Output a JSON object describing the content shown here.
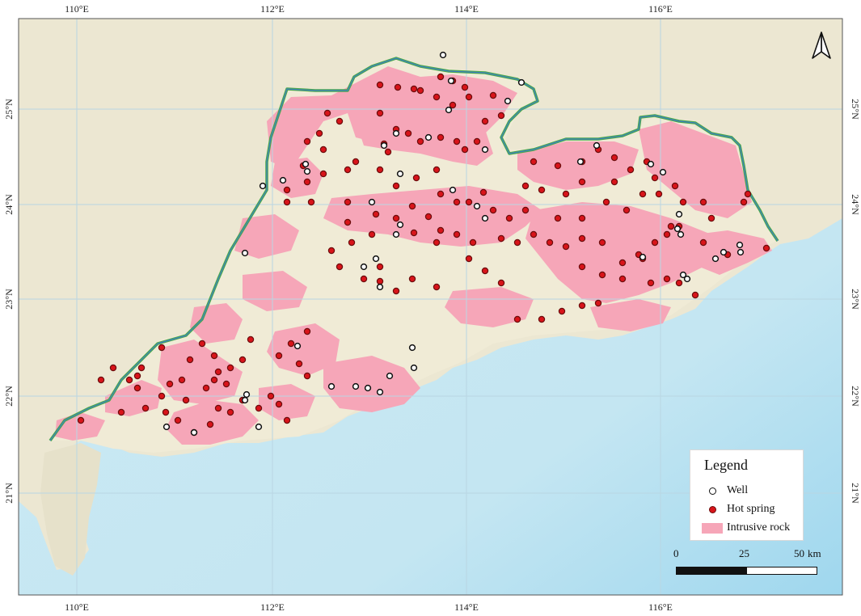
{
  "map": {
    "graticule": {
      "top_lon": [
        "110°E",
        "112°E",
        "114°E",
        "116°E"
      ],
      "bottom_lon": [
        "110°E",
        "112°E",
        "114°E",
        "116°E"
      ],
      "left_lat": [
        "25°N",
        "24°N",
        "23°N",
        "22°N",
        "21°N"
      ],
      "right_lat": [
        "25°N",
        "24°N",
        "23°N",
        "22°N",
        "21°N"
      ]
    },
    "north_arrow_icon": "north-arrow-icon",
    "colors": {
      "land": "#ece7d2",
      "sea": "#c8e8f3",
      "intrusive_rock": "#f6a6b8",
      "hot_spring": "#d8141a",
      "boundary": "#4aa84a",
      "graticule": "#b9d6e3"
    }
  },
  "legend": {
    "title": "Legend",
    "items": [
      {
        "label": "Well",
        "icon": "well-marker-icon"
      },
      {
        "label": "Hot spring",
        "icon": "hot-spring-marker-icon"
      },
      {
        "label": "Intrusive rock",
        "icon": "intrusive-rock-swatch-icon"
      }
    ]
  },
  "scale_bar": {
    "labels": [
      "0",
      "25",
      "50"
    ],
    "unit": "km"
  }
}
